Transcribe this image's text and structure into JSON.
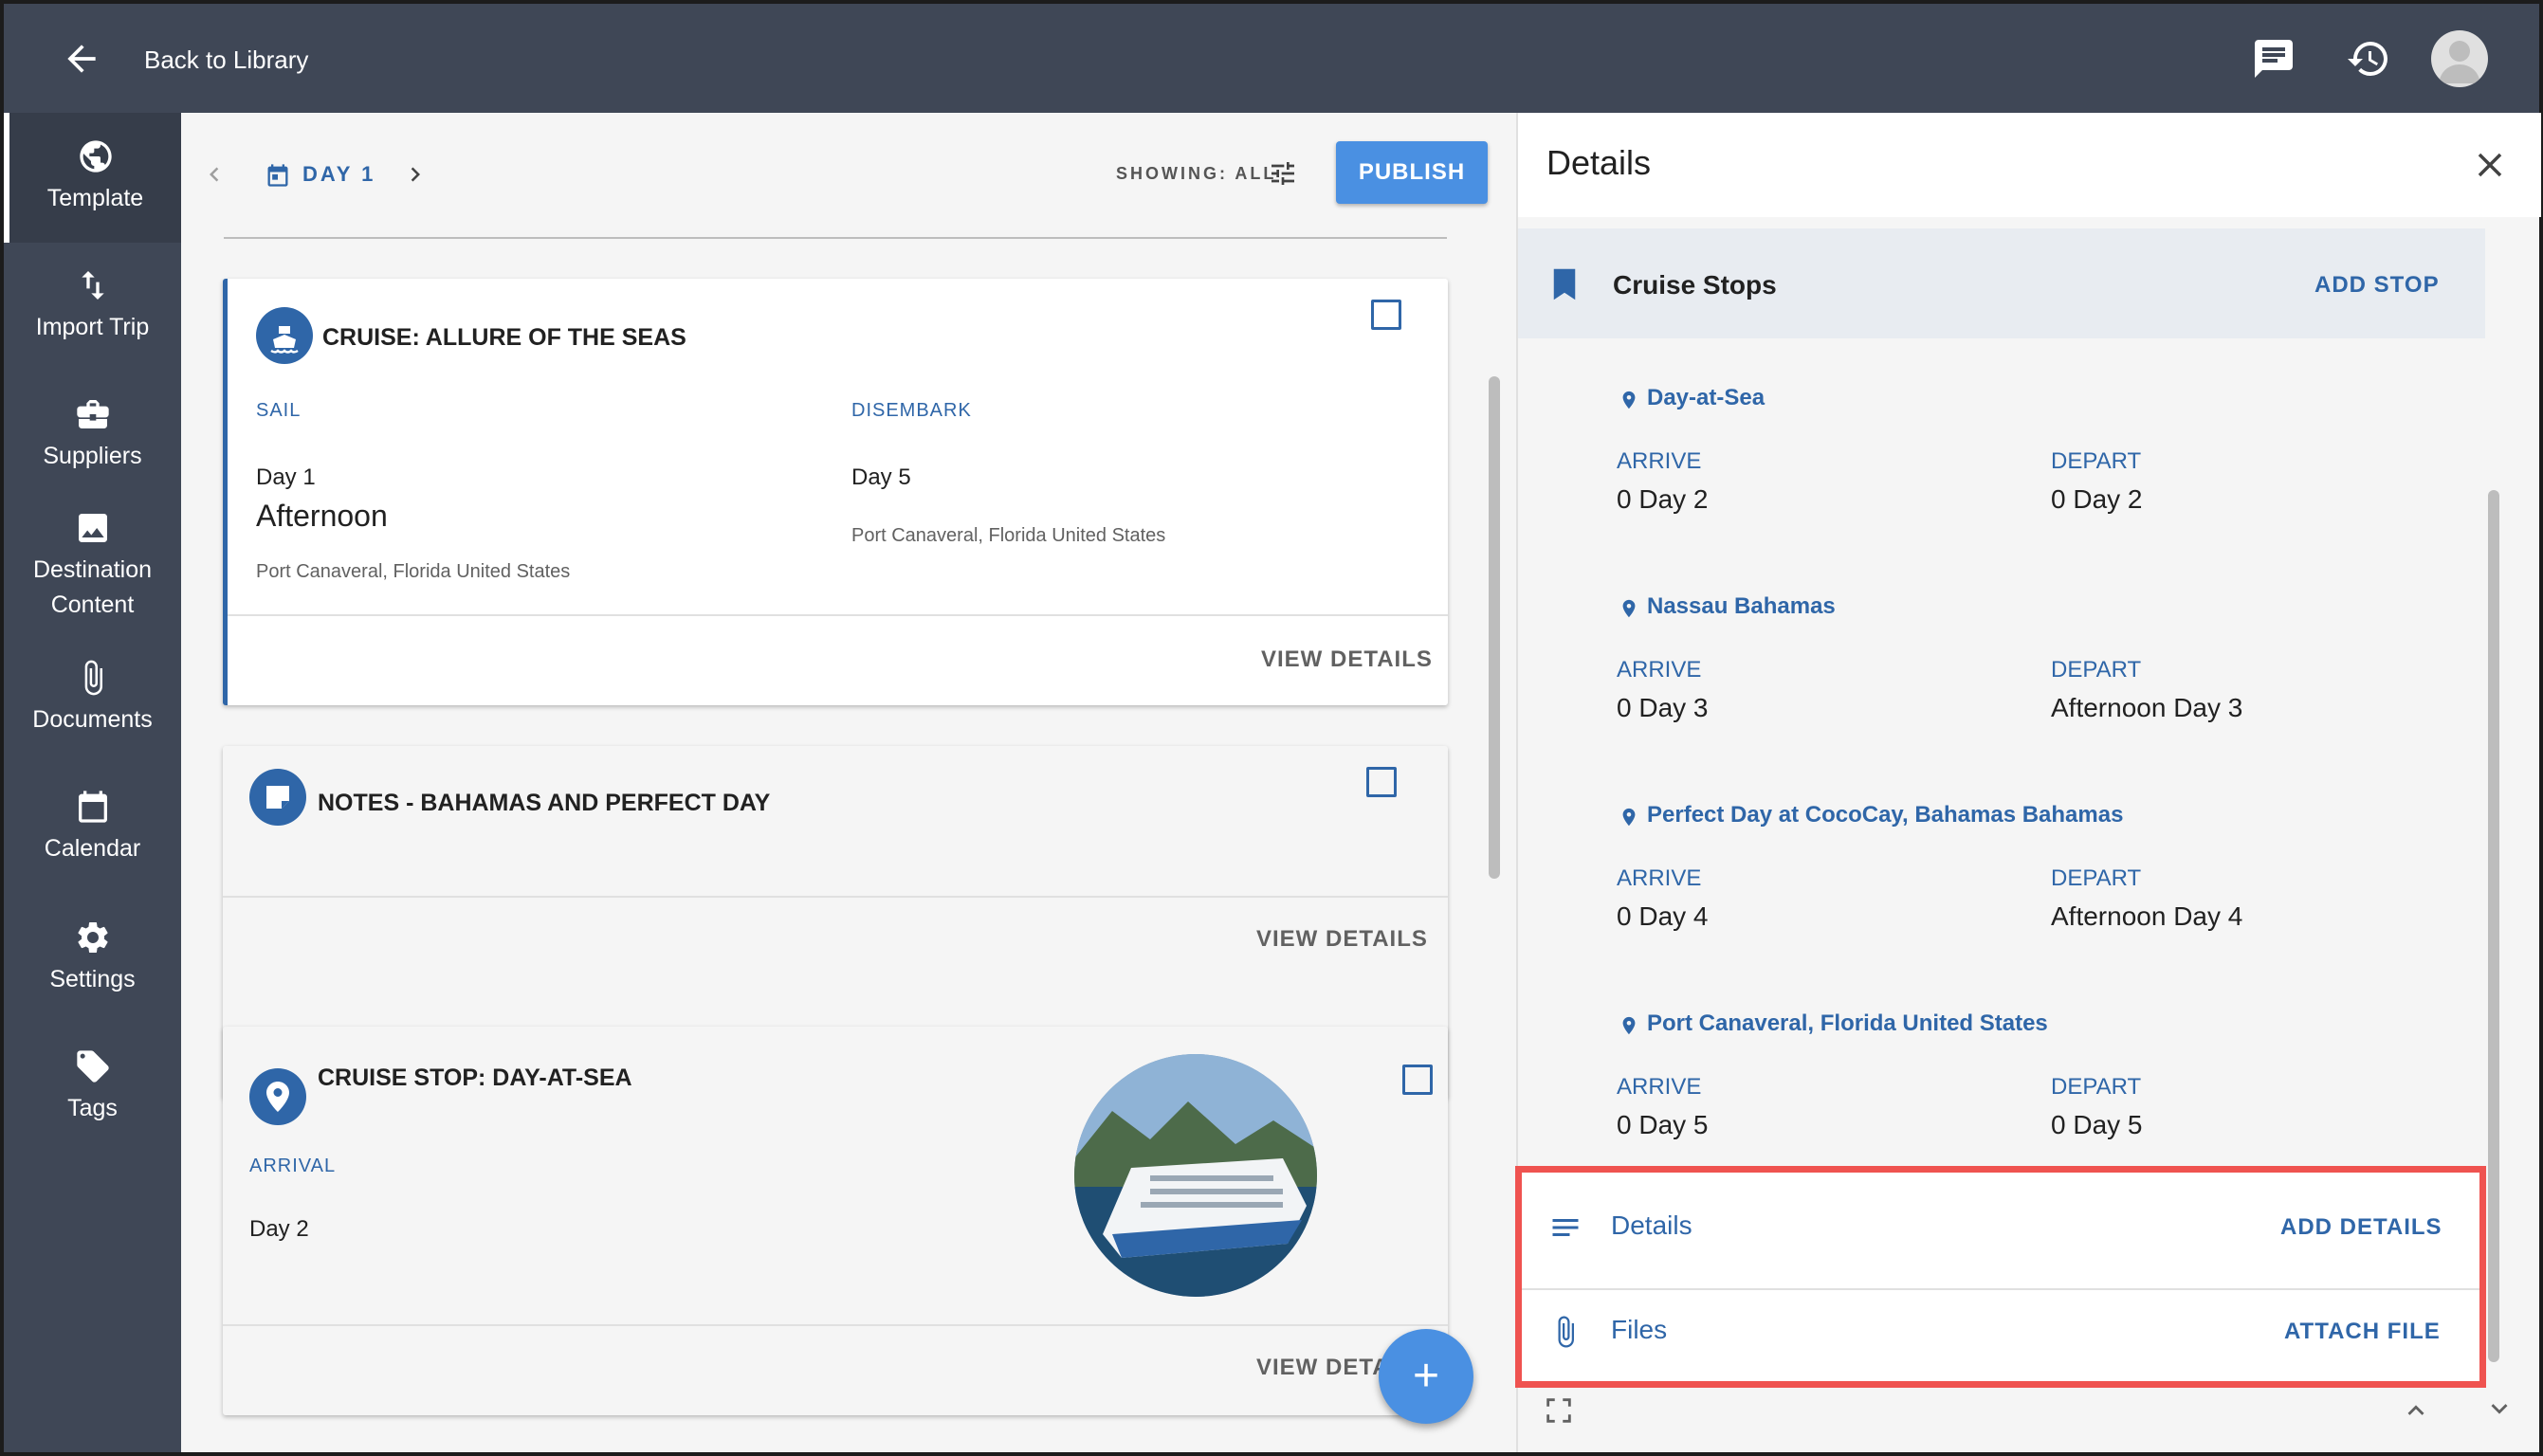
{
  "topbar": {
    "back_label": "Back to Library",
    "icons": [
      "chat-icon",
      "history-icon",
      "avatar"
    ]
  },
  "sidebar": {
    "items": [
      {
        "label": "Template",
        "icon": "globe-icon",
        "active": true
      },
      {
        "label": "Import Trip",
        "icon": "swap-vertical-icon"
      },
      {
        "label": "Suppliers",
        "icon": "briefcase-icon"
      },
      {
        "label": "Destination Content",
        "icon": "image-icon"
      },
      {
        "label": "Documents",
        "icon": "paperclip-icon"
      },
      {
        "label": "Calendar",
        "icon": "calendar-icon"
      },
      {
        "label": "Settings",
        "icon": "gear-icon"
      },
      {
        "label": "Tags",
        "icon": "tag-icon"
      }
    ]
  },
  "middle": {
    "day_label": "DAY 1",
    "showing_label": "SHOWING: ALL",
    "publish_label": "PUBLISH",
    "cards": [
      {
        "title": "CRUISE: ALLURE OF THE SEAS",
        "sail_label": "SAIL",
        "sail_day": "Day 1",
        "sail_time": "Afternoon",
        "sail_location": "Port Canaveral, Florida United States",
        "disembark_label": "DISEMBARK",
        "disembark_day": "Day 5",
        "disembark_location": "Port Canaveral, Florida United States",
        "action": "VIEW DETAILS"
      },
      {
        "title": "NOTES - BAHAMAS AND PERFECT DAY",
        "action": "VIEW DETAILS"
      },
      {
        "title": "CRUISE STOP: DAY-AT-SEA",
        "arrival_label": "ARRIVAL",
        "arrival_day": "Day 2",
        "action": "VIEW DETA"
      }
    ],
    "fab_label": "+"
  },
  "details": {
    "title": "Details",
    "stops_title": "Cruise Stops",
    "add_stop": "ADD STOP",
    "arrive_label": "ARRIVE",
    "depart_label": "DEPART",
    "stops": [
      {
        "name": "Day-at-Sea",
        "arrive": "0 Day 2",
        "depart": "0 Day 2"
      },
      {
        "name": "Nassau Bahamas",
        "arrive": "0 Day 3",
        "depart": "Afternoon Day 3"
      },
      {
        "name": "Perfect Day at CocoCay, Bahamas Bahamas",
        "arrive": "0 Day 4",
        "depart": "Afternoon Day 4"
      },
      {
        "name": "Port Canaveral, Florida United States",
        "arrive": "0 Day 5",
        "depart": "0 Day 5"
      }
    ],
    "details_row": {
      "label": "Details",
      "action": "ADD DETAILS"
    },
    "files_row": {
      "label": "Files",
      "action": "ATTACH FILE"
    }
  },
  "colors": {
    "topbar": "#3f4756",
    "accent": "#2f66a8",
    "button": "#4a90e2",
    "highlight": "#ef5350"
  }
}
